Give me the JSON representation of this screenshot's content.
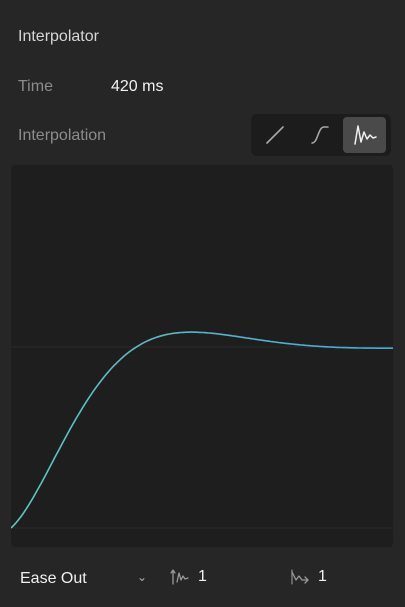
{
  "panel": {
    "title": "Interpolator"
  },
  "time": {
    "label": "Time",
    "value": "420 ms"
  },
  "interpolation": {
    "label": "Interpolation",
    "options": [
      {
        "icon": "linear-curve-icon",
        "active": false
      },
      {
        "icon": "s-curve-icon",
        "active": false
      },
      {
        "icon": "spring-curve-icon",
        "active": true
      }
    ]
  },
  "graph": {
    "curve_color": "#5ec6c0",
    "curve_color_end": "#4aa6d8"
  },
  "footer": {
    "preset": "Ease Out",
    "stiffness_value": "1",
    "damping_value": "1"
  }
}
